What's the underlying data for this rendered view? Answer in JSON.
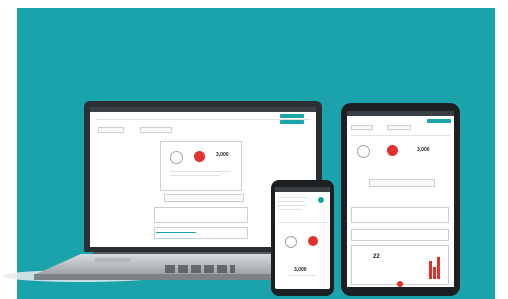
{
  "laptop": {
    "app_title": "",
    "nav_items": [
      "",
      "",
      ""
    ],
    "action_button": "",
    "metrics": [
      {
        "label": "",
        "value": "",
        "color": "#ffffff"
      },
      {
        "label": "",
        "value": "",
        "color": "#e0312c"
      },
      {
        "label": "",
        "value": "3,000",
        "color": "#ffffff"
      }
    ]
  },
  "phone": {
    "metric_value": "3,000"
  },
  "tablet": {
    "metric_value": "3,000",
    "big_number": "22"
  },
  "colors": {
    "background": "#1aa3aa",
    "accent": "#1aa3aa",
    "alert": "#e0312c",
    "device_frame": "#1d2023"
  }
}
